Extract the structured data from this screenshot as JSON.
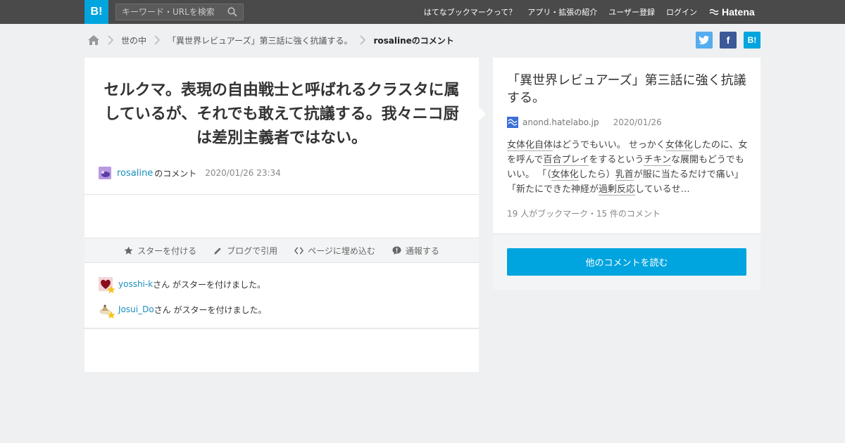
{
  "header": {
    "logo": "B!",
    "search_placeholder": "キーワード・URLを検索",
    "nav": [
      "はてなブックマークって？",
      "アプリ・拡張の紹介",
      "ユーザー登録",
      "ログイン"
    ],
    "brand": "Hatena"
  },
  "breadcrumb": {
    "items": [
      "世の中",
      "「異世界レビュアーズ」第三話に強く抗議する。"
    ],
    "current": "rosalineのコメント"
  },
  "share": {
    "twitter": "t",
    "facebook": "f",
    "hatebu": "B!"
  },
  "comment": {
    "text": "セルクマ。表現の自由戦士と呼ばれるクラスタに属しているが、それでも敢えて抗議する。我々ニコ厨は差別主義者ではない。",
    "user": "rosaline",
    "suffix": "のコメント",
    "date": "2020/01/26 23:34"
  },
  "actions": [
    "スターを付ける",
    "ブログで引用",
    "ページに埋め込む",
    "通報する"
  ],
  "stars": [
    {
      "user": "yosshi-k",
      "text": "さん がスターを付けました。"
    },
    {
      "user": "Josui_Do",
      "text": "さん がスターを付けました。"
    }
  ],
  "entry": {
    "title": "「異世界レビュアーズ」第三話に強く抗議する。",
    "domain": "anond.hatelabo.jp",
    "date": "2020/01/26",
    "excerpt": [
      "女体化自体",
      "はどうでもいい。 せっかく",
      "女体化",
      "したのに、女を呼んで",
      "百合プレイ",
      "をするという",
      "チキン",
      "な展開もどうでもいい。 「（",
      "女体化",
      "したら）",
      "乳首",
      "が服に当たるだけで痛い」「新たにできた神経が",
      "過剰反応",
      "しているせ…"
    ],
    "counts": "19 人がブックマーク・15 件のコメント",
    "read_button": "他のコメントを読む"
  },
  "colors": {
    "accent": "#00a4de",
    "topbar": "#4a4a4a",
    "link": "#1a8fbf",
    "star": "#f5c518"
  }
}
